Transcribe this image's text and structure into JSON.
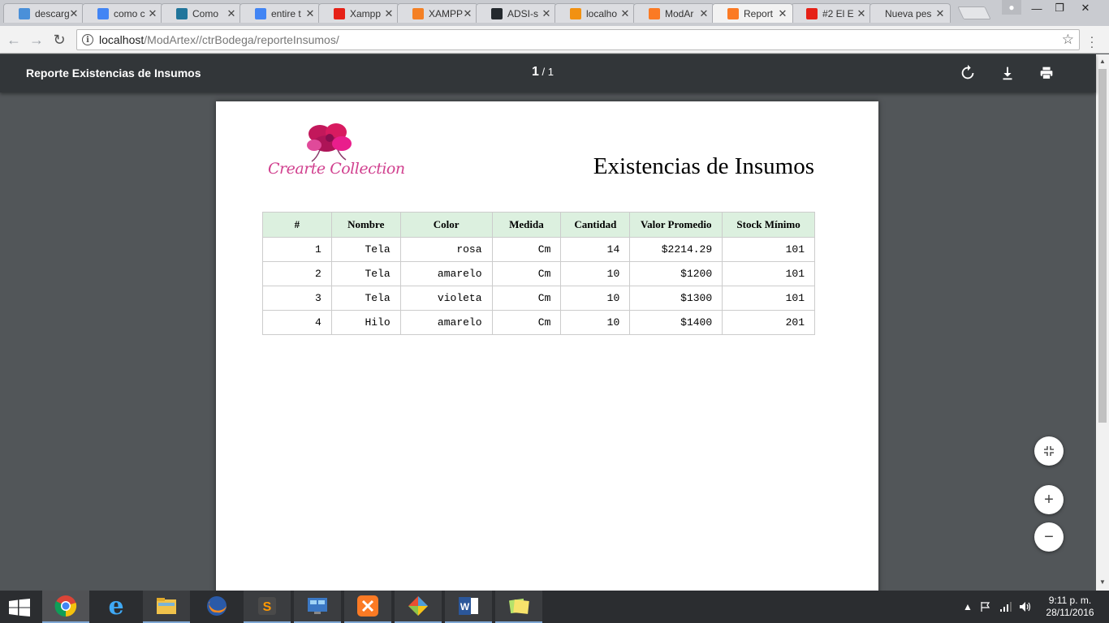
{
  "browser": {
    "tabs": [
      {
        "label": "descarg",
        "icon": "download-favicon",
        "color": "#4a90d9"
      },
      {
        "label": "como c",
        "icon": "google-favicon",
        "color": "#4285f4"
      },
      {
        "label": "Como",
        "icon": "wordpress-favicon",
        "color": "#21759b"
      },
      {
        "label": "entire t",
        "icon": "google-favicon",
        "color": "#4285f4"
      },
      {
        "label": "Xampp",
        "icon": "youtube-favicon",
        "color": "#e62117"
      },
      {
        "label": "XAMPP",
        "icon": "stackoverflow-favicon",
        "color": "#f48024"
      },
      {
        "label": "ADSI-s",
        "icon": "github-favicon",
        "color": "#24292e"
      },
      {
        "label": "localho",
        "icon": "phpmyadmin-favicon",
        "color": "#f29111"
      },
      {
        "label": "ModAr",
        "icon": "xampp-favicon",
        "color": "#fb7a24"
      },
      {
        "label": "Report",
        "icon": "xampp-favicon",
        "color": "#fb7a24",
        "active": true
      },
      {
        "label": "#2 El E",
        "icon": "youtube-favicon",
        "color": "#e62117"
      },
      {
        "label": "Nueva pes",
        "icon": "",
        "color": ""
      }
    ],
    "url_host": "localhost",
    "url_path": "/ModArtex//ctrBodega/reporteInsumos/"
  },
  "pdf": {
    "title": "Reporte Existencias de Insumos",
    "page_current": "1",
    "page_total": "/ 1"
  },
  "document": {
    "logo_text": "Crearte Collection",
    "heading": "Existencias de Insumos",
    "table": {
      "headers": [
        "#",
        "Nombre",
        "Color",
        "Medida",
        "Cantidad",
        "Valor Promedio",
        "Stock Mínimo"
      ],
      "rows": [
        [
          "1",
          "Tela",
          "rosa",
          "Cm",
          "14",
          "$2214.29",
          "101"
        ],
        [
          "2",
          "Tela",
          "amarelo",
          "Cm",
          "10",
          "$1200",
          "101"
        ],
        [
          "3",
          "Tela",
          "violeta",
          "Cm",
          "10",
          "$1300",
          "101"
        ],
        [
          "4",
          "Hilo",
          "amarelo",
          "Cm",
          "10",
          "$1400",
          "201"
        ]
      ]
    }
  },
  "taskbar": {
    "clock_time": "9:11 p. m.",
    "clock_date": "28/11/2016"
  }
}
